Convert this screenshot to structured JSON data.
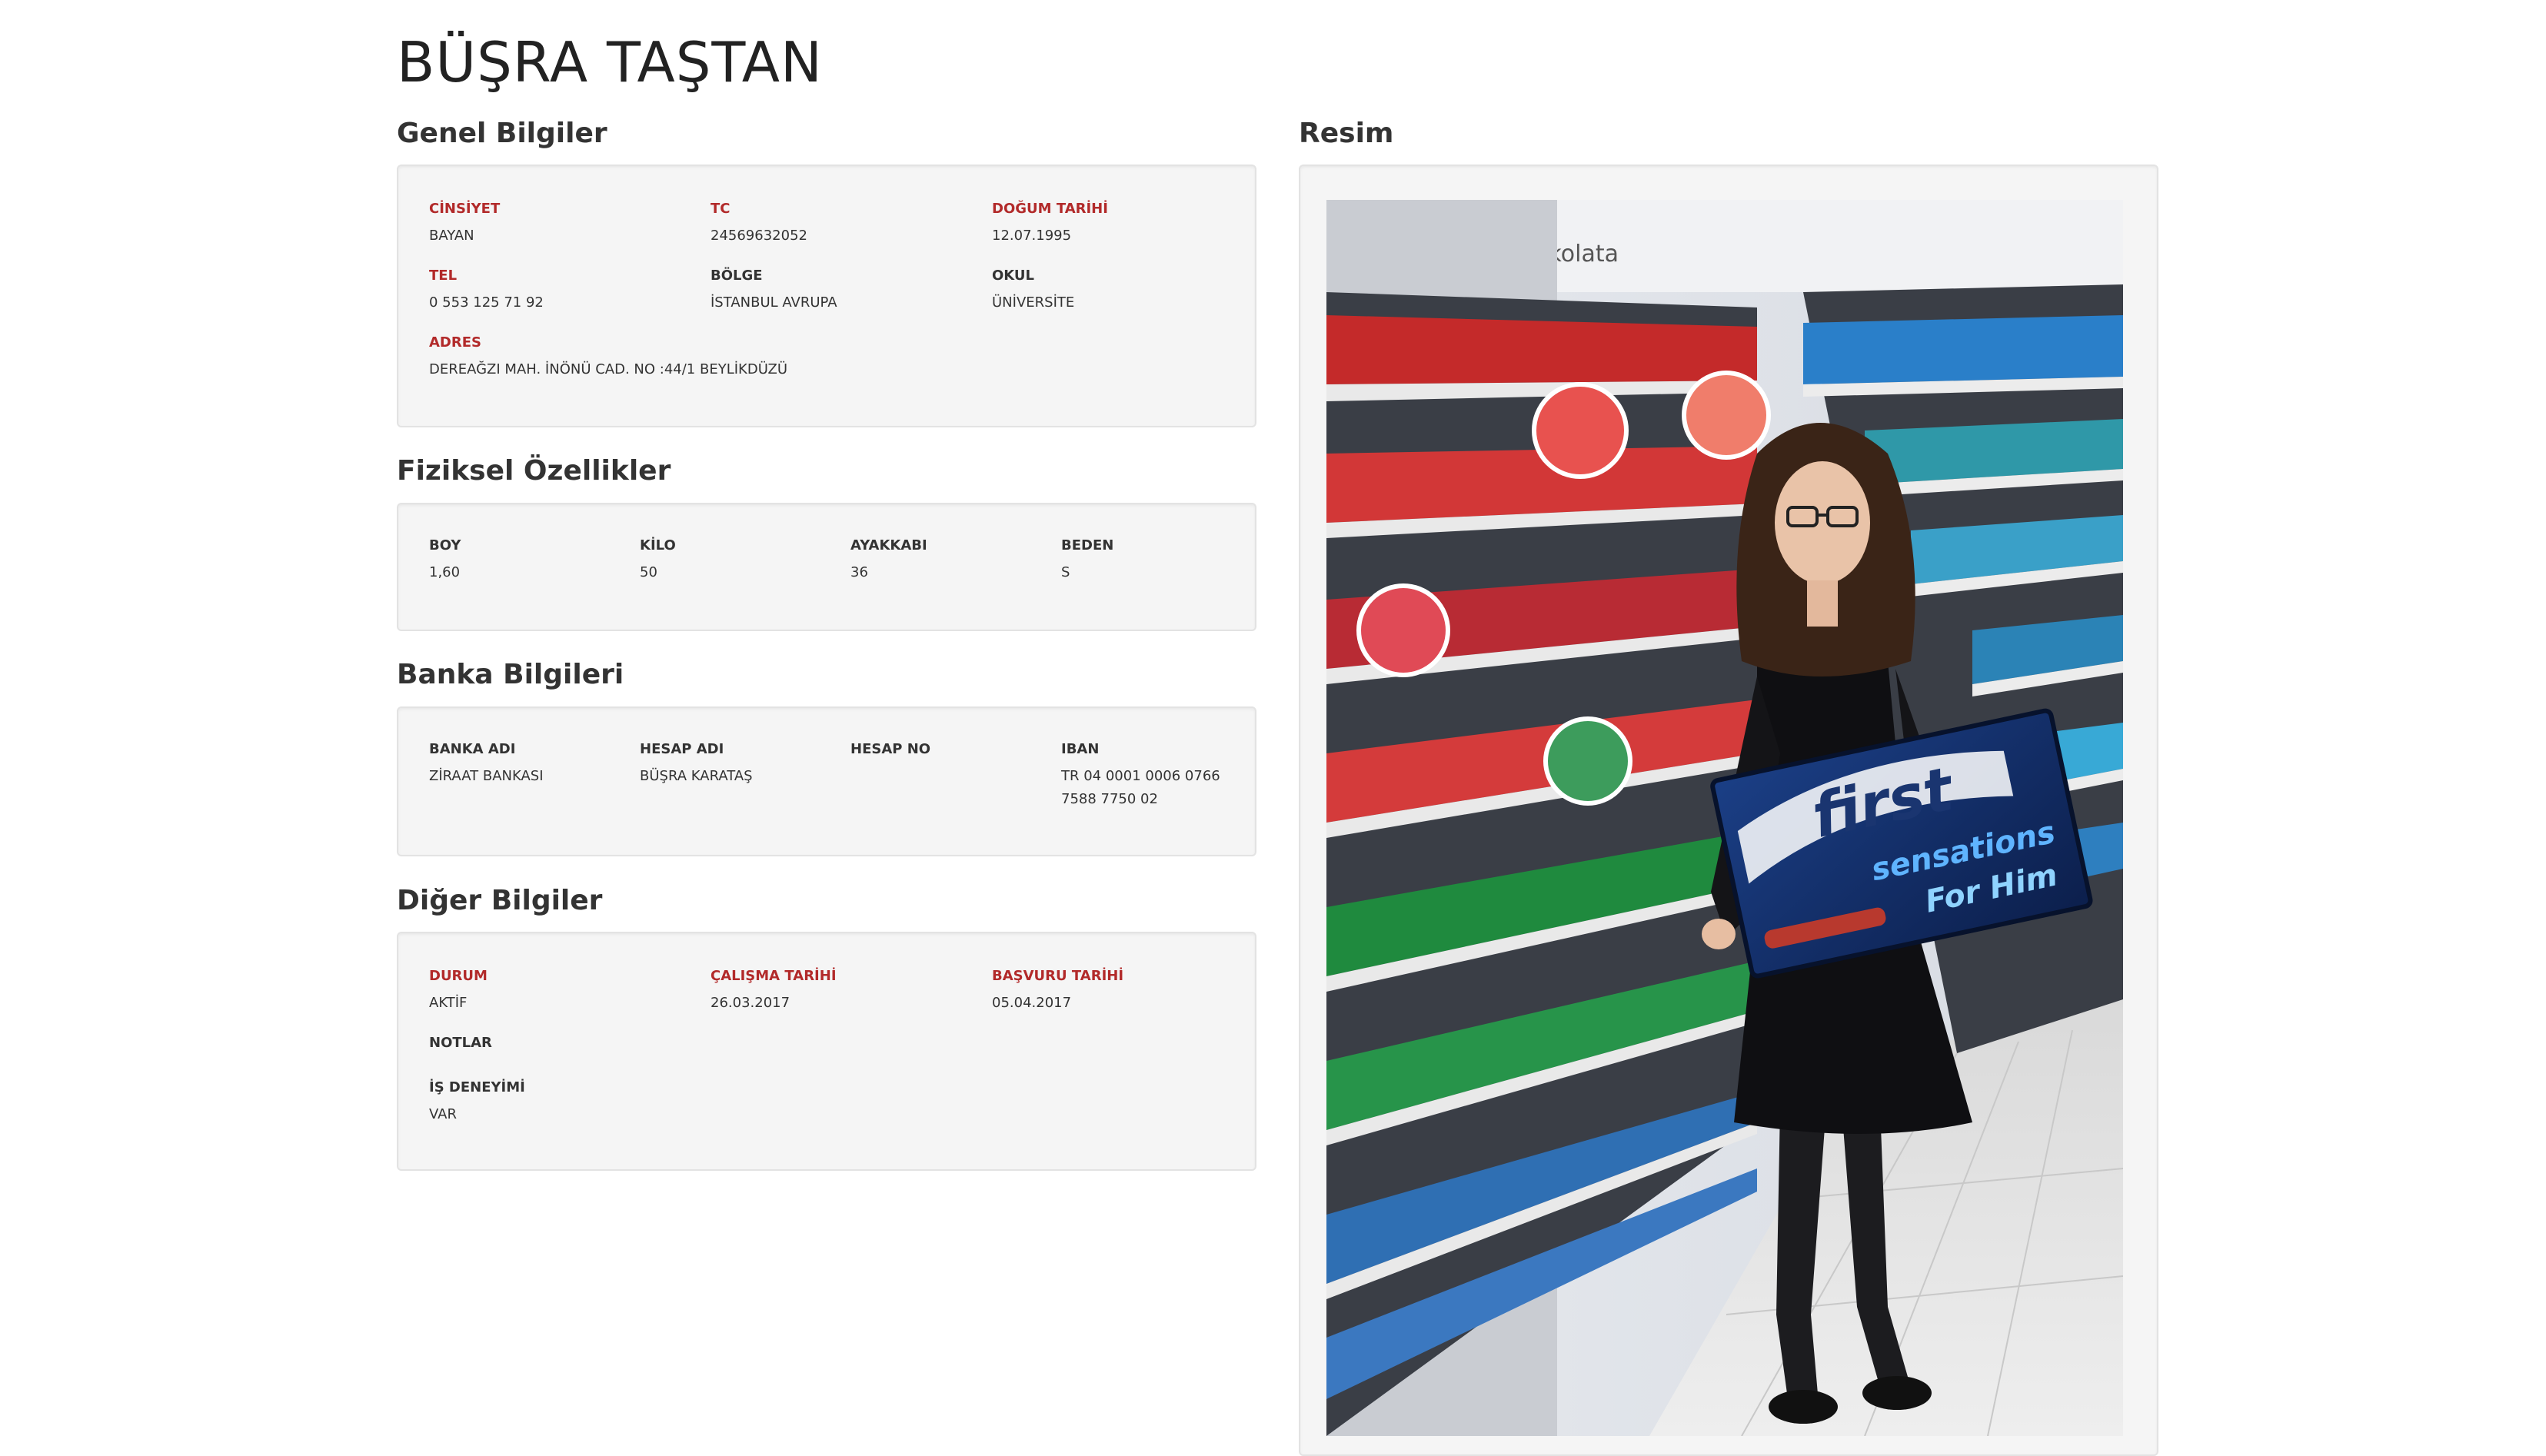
{
  "person": {
    "name": "BÜŞRA TAŞTAN"
  },
  "sections": {
    "general": {
      "title": "Genel Bilgiler",
      "cinsiyet": {
        "label": "CİNSİYET",
        "value": "BAYAN"
      },
      "tc": {
        "label": "TC",
        "value": "24569632052"
      },
      "dogum": {
        "label": "DOĞUM TARİHİ",
        "value": "12.07.1995"
      },
      "tel": {
        "label": "TEL",
        "value": "0 553 125 71 92"
      },
      "bolge": {
        "label": "BÖLGE",
        "value": "İSTANBUL AVRUPA"
      },
      "okul": {
        "label": "OKUL",
        "value": "ÜNİVERSİTE"
      },
      "adres": {
        "label": "ADRES",
        "value": "DEREAĞZI MAH. İNÖNÜ CAD. NO :44/1 BEYLİKDÜZÜ"
      }
    },
    "physical": {
      "title": "Fiziksel Özellikler",
      "boy": {
        "label": "BOY",
        "value": "1,60"
      },
      "kilo": {
        "label": "KİLO",
        "value": "50"
      },
      "ayakkabi": {
        "label": "AYAKKABI",
        "value": "36"
      },
      "beden": {
        "label": "BEDEN",
        "value": "S"
      }
    },
    "bank": {
      "title": "Banka Bilgileri",
      "banka_adi": {
        "label": "BANKA ADI",
        "value": "ZİRAAT BANKASI"
      },
      "hesap_adi": {
        "label": "HESAP ADI",
        "value": "BÜŞRA KARATAŞ"
      },
      "hesap_no": {
        "label": "HESAP NO",
        "value": ""
      },
      "iban": {
        "label": "IBAN",
        "value": "TR 04 0001 0006 0766 7588 7750 02"
      }
    },
    "other": {
      "title": "Diğer Bilgiler",
      "durum": {
        "label": "DURUM",
        "value": "AKTİF"
      },
      "calisma": {
        "label": "ÇALIŞMA TARİHİ",
        "value": "26.03.2017"
      },
      "basvuru": {
        "label": "BAŞVURU TARİHİ",
        "value": "05.04.2017"
      },
      "notlar": {
        "label": "NOTLAR",
        "value": ""
      },
      "is_deneyimi": {
        "label": "İŞ DENEYİMİ",
        "value": "VAR"
      }
    },
    "photo": {
      "title": "Resim",
      "sign_text": "bisküvi, çikolata",
      "brand": "first",
      "brand_line2": "sensations",
      "brand_line3": "For Him"
    }
  },
  "colors": {
    "label_red": "#b22a2a",
    "well_bg": "#f5f5f5",
    "well_border": "#e3e3e3"
  }
}
